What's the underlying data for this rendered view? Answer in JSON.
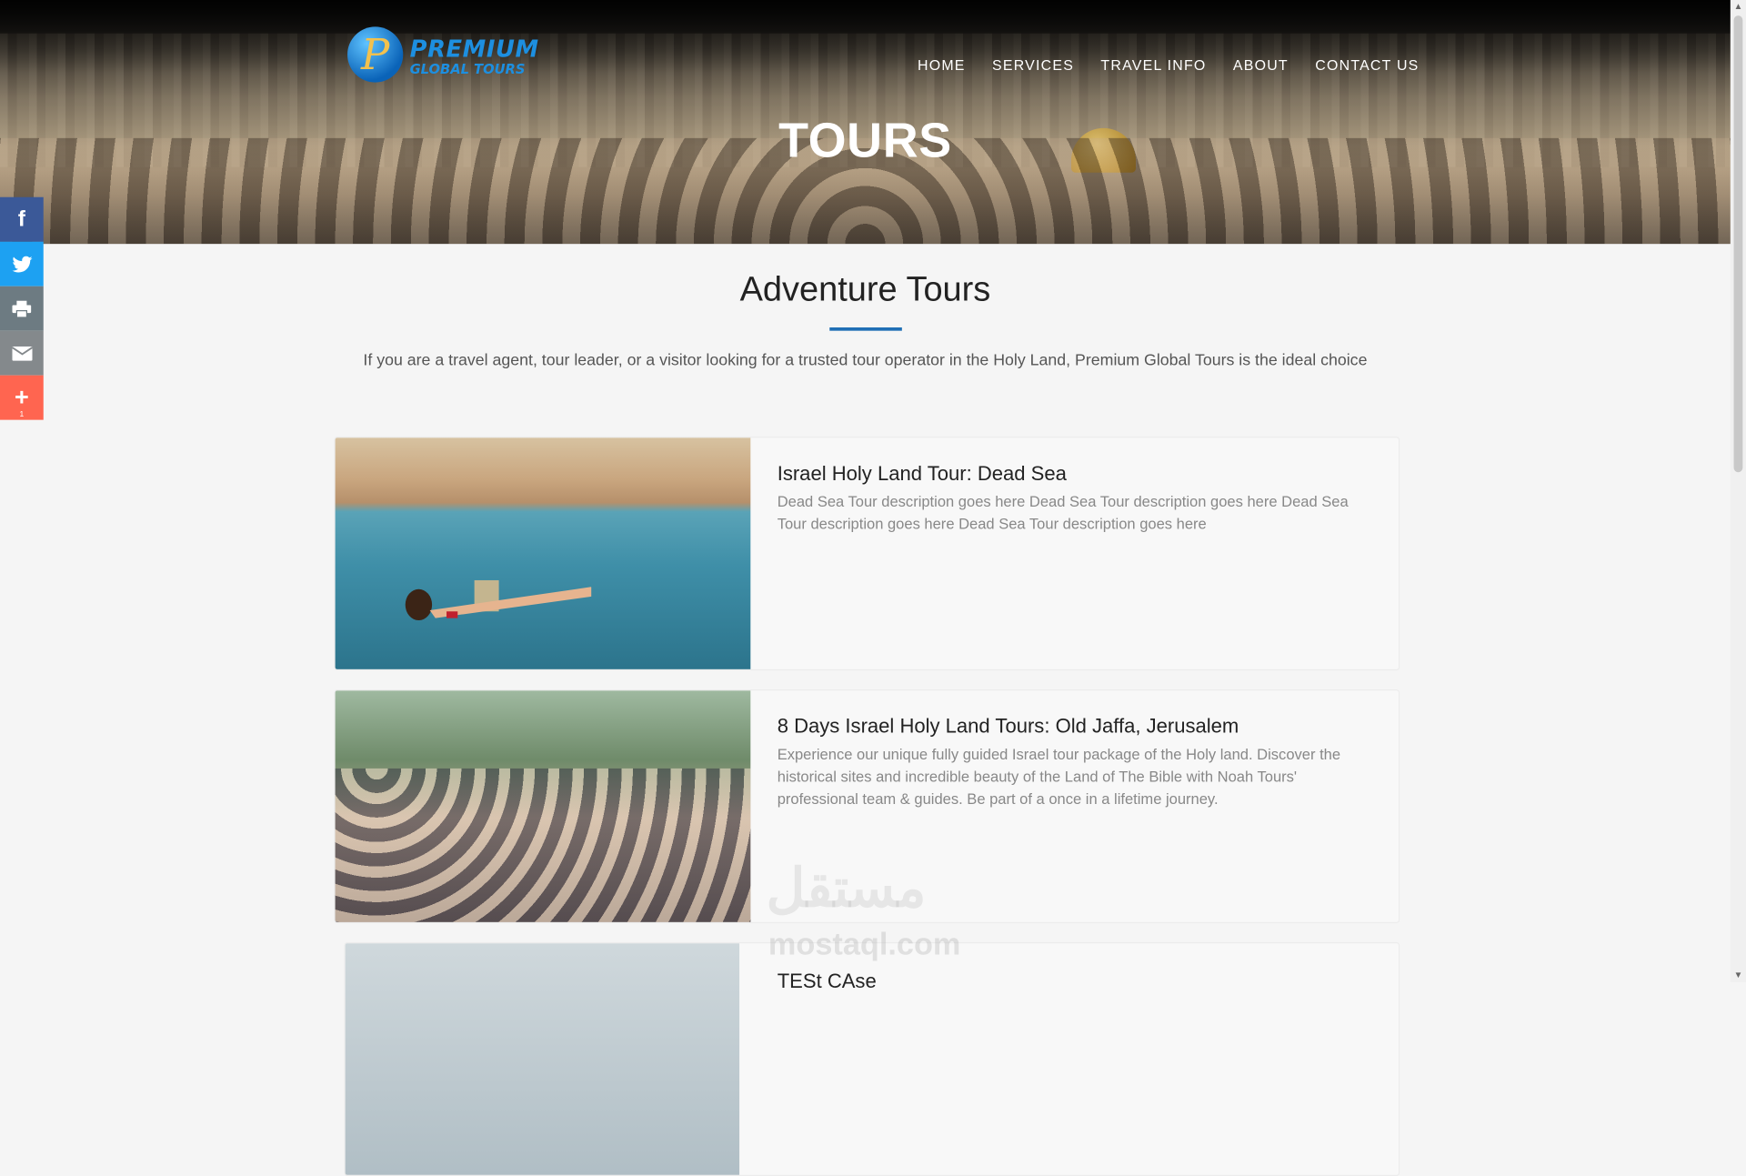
{
  "logo": {
    "mark": "P",
    "line1": "PREMIUM",
    "line2": "GLOBAL TOURS"
  },
  "nav": [
    "HOME",
    "SERVICES",
    "TRAVEL INFO",
    "ABOUT",
    "CONTACT US"
  ],
  "hero": {
    "title": "TOURS"
  },
  "social": {
    "icons": [
      "facebook-icon",
      "twitter-icon",
      "print-icon",
      "email-icon",
      "plus-icon"
    ],
    "share_count": "1"
  },
  "section": {
    "title": "Adventure Tours",
    "description": "If you are a travel agent, tour leader, or a visitor looking for a trusted tour operator in the Holy Land, Premium Global Tours is the ideal choice"
  },
  "tours": [
    {
      "title": "Israel Holy Land Tour: Dead Sea",
      "description": "Dead Sea Tour description goes here Dead Sea Tour description goes here Dead Sea Tour description goes here Dead Sea Tour description goes here"
    },
    {
      "title": "8 Days Israel Holy Land Tours: Old Jaffa, Jerusalem",
      "description": "Experience our unique fully guided Israel tour package of the Holy land. Discover the historical sites and incredible beauty of the Land of The Bible with Noah Tours' professional team & guides. Be part of a once in a lifetime journey."
    },
    {
      "title": "TESt CAse",
      "description": ""
    }
  ],
  "watermark": {
    "arabic": "مستقل",
    "latin": "mostaql.com"
  }
}
